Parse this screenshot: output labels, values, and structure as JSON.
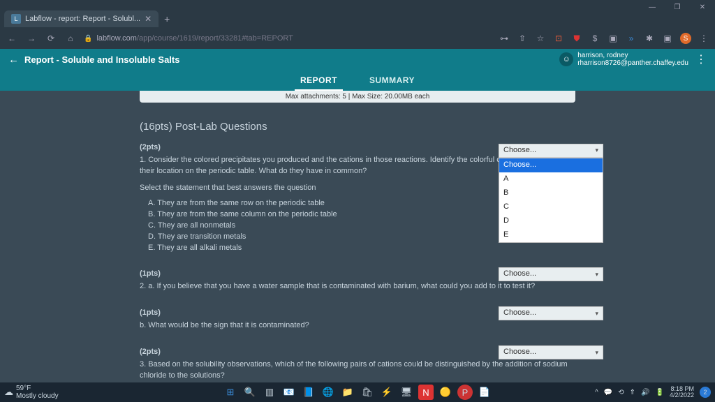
{
  "window": {
    "tab_title": "Labflow - report: Report - Solubl...",
    "minimize": "—",
    "maximize": "❐",
    "close": "✕"
  },
  "addr": {
    "host": "labflow.com",
    "path": "/app/course/1619/report/33281#tab=REPORT",
    "newtab": "+",
    "back": "←",
    "fwd": "→",
    "reload": "⟳",
    "home": "⌂",
    "lock": "🔒",
    "icons": {
      "key": "⊶",
      "share": "⇧",
      "star": "☆",
      "tray": "⊡",
      "shield": "⛊",
      "dollar": "$",
      "cube": "▣",
      "ext": "»",
      "piece": "✱",
      "stop": "▣",
      "avatar": "S",
      "more": "⋮"
    }
  },
  "header": {
    "back": "←",
    "title": "Report - Soluble and Insoluble Salts",
    "user_name": "harrison, rodney",
    "user_email": "rharrison8726@panther.chaffey.edu",
    "avatar": "☺",
    "kebab": "⋮"
  },
  "tabs": {
    "report": "REPORT",
    "summary": "SUMMARY"
  },
  "attach": "Max attachments: 5 | Max Size: 20.00MB each",
  "section_title": "(16pts) Post-Lab Questions",
  "q1": {
    "pts": "(2pts)",
    "text": "1. Consider the colored precipitates you produced and the cations in those reactions. Identify the colorful cations and describe their location on the periodic table. What do they have in common?",
    "sub": "Select the statement that best answers the question",
    "optA": "A. They are from the same row on the periodic table",
    "optB": "B. They are from the same column on the periodic table",
    "optC": "C. They are all nonmetals",
    "optD": "D. They are transition metals",
    "optE": "E. They are all alkali metals",
    "choose": "Choose..."
  },
  "dropdown": {
    "i0": "Choose...",
    "i1": "A",
    "i2": "B",
    "i3": "C",
    "i4": "D",
    "i5": "E"
  },
  "q2": {
    "pts": "(1pts)",
    "text": "2. a. If you believe that you have a water sample that is contaminated with barium, what could you add to it to test it?",
    "choose": "Choose..."
  },
  "q3": {
    "pts": "(1pts)",
    "text": "b. What would be the sign that it is contaminated?",
    "choose": "Choose..."
  },
  "q4": {
    "pts": "(2pts)",
    "text": "3. Based on the solubility observations, which of the following pairs of cations could be distinguished by the addition of sodium chloride to the solutions?",
    "choose": "Choose..."
  },
  "taskbar": {
    "temp": "59°F",
    "cond": "Mostly cloudy",
    "time": "8:18 PM",
    "date": "4/2/2022",
    "tray": {
      "up": "^",
      "chat": "💬",
      "sync": "⟲",
      "wifi": "⇑",
      "vol": "🔊",
      "batt": "🔋"
    }
  },
  "caret": "▾"
}
